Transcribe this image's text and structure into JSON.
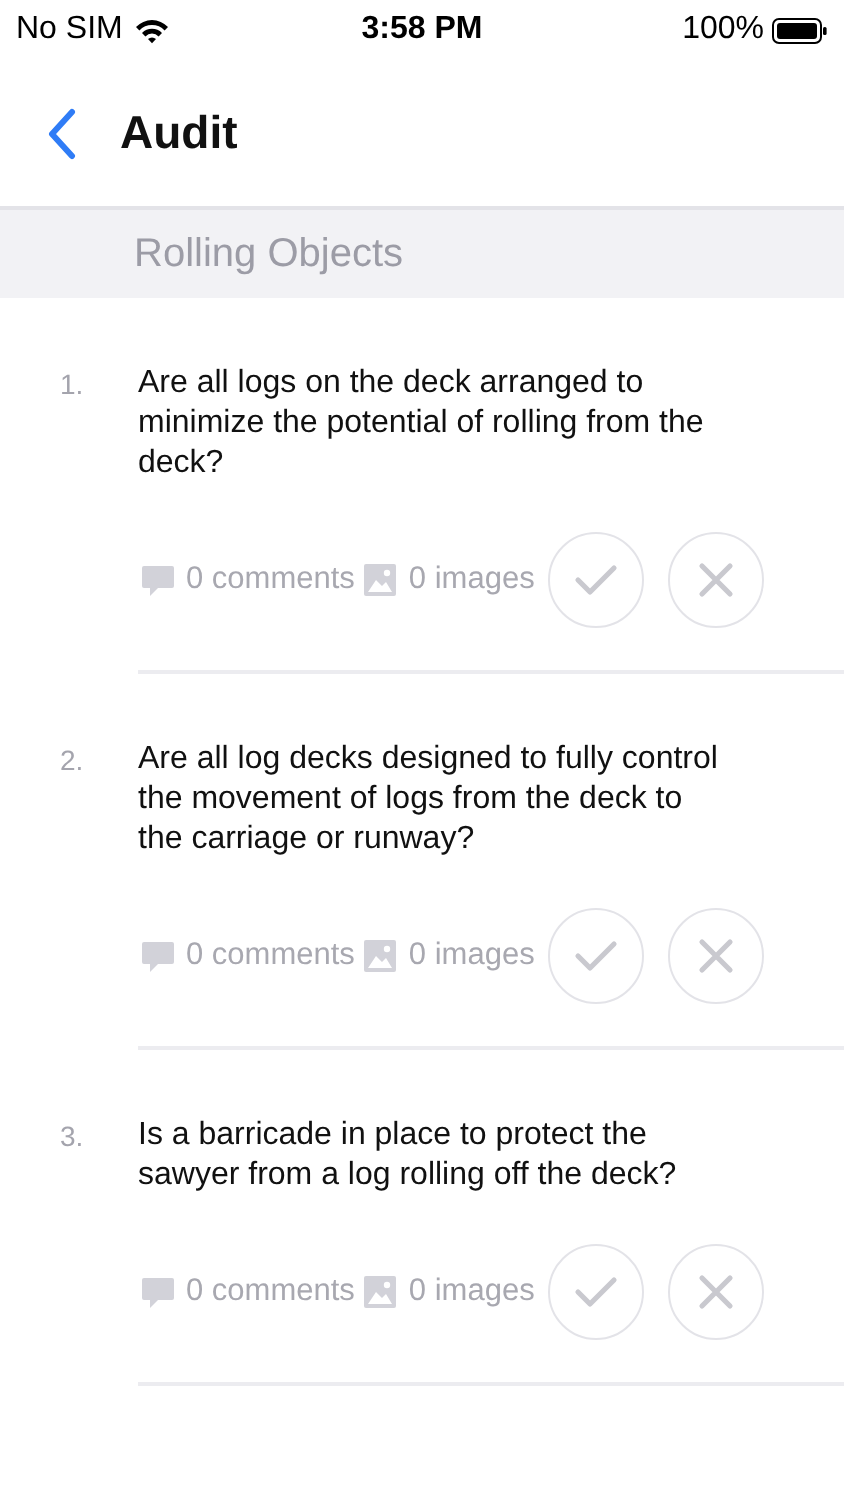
{
  "status_bar": {
    "carrier": "No SIM",
    "time": "3:58 PM",
    "battery": "100%"
  },
  "nav": {
    "title": "Audit"
  },
  "section": {
    "title": "Rolling Objects"
  },
  "questions": [
    {
      "number": "1.",
      "text": "Are all logs on the deck arranged to minimize the potential of rolling from the deck?",
      "comments": "0 comments",
      "images": "0 images"
    },
    {
      "number": "2.",
      "text": "Are all log decks designed to fully control the movement of logs from the deck to the carriage or runway?",
      "comments": "0 comments",
      "images": "0 images"
    },
    {
      "number": "3.",
      "text": "Is a barricade in place to protect the sawyer from a log rolling off the deck?",
      "comments": "0 comments",
      "images": "0 images"
    }
  ]
}
